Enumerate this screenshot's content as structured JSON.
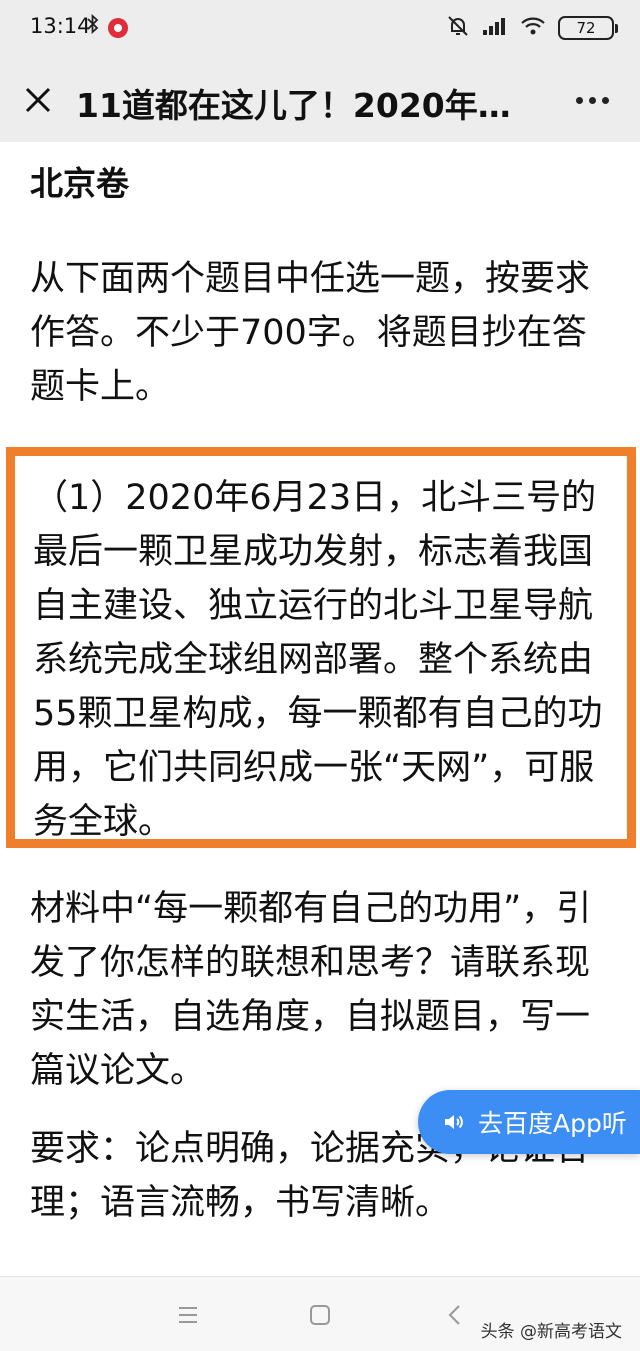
{
  "status_bar": {
    "time": "13:14",
    "battery": "72",
    "icons": [
      "bluetooth-icon",
      "record-icon",
      "mute-icon",
      "signal-icon",
      "wifi-icon",
      "battery-icon"
    ]
  },
  "nav": {
    "title": "11道都在这儿了！2020年…"
  },
  "article": {
    "section_title": "北京卷",
    "intro": "从下面两个题目中任选一题，按要求作答。不少于700字。将题目抄在答题卡上。",
    "quote": "（1）2020年6月23日，北斗三号的最后一颗卫星成功发射，标志着我国自主建设、独立运行的北斗卫星导航系统完成全球组网部署。整个系统由55颗卫星构成，每一颗都有自己的功用，它们共同织成一张“天网”，可服务全球。",
    "question": "材料中“每一颗都有自己的功用”，引发了你怎样的联想和思考？请联系现实生活，自选角度，自拟题目，写一篇议论文。",
    "requirements": "要求：论点明确，论据充实，论证合理；语言流畅，书写清晰。"
  },
  "listen_button": {
    "label": "去百度App听"
  },
  "watermark": "头条 @新高考语文",
  "colors": {
    "highlight_border": "#f07f2b",
    "listen_button": "#3c8ef4",
    "bar_background": "#ededed"
  }
}
